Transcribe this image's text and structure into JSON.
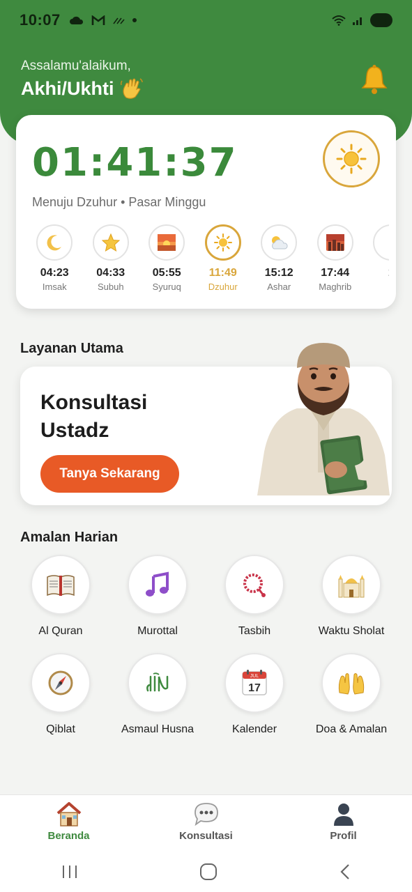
{
  "status_bar": {
    "time": "10:07",
    "battery": "73"
  },
  "header": {
    "greeting": "Assalamu'alaikum,",
    "username": "Akhi/Ukhti"
  },
  "prayer_card": {
    "countdown": "01:41:37",
    "subtitle": "Menuju Dzuhur • Pasar Minggu",
    "prayers": [
      {
        "time": "04:23",
        "name": "Imsak",
        "icon": "crescent-moon-icon",
        "active": false
      },
      {
        "time": "04:33",
        "name": "Subuh",
        "icon": "star-icon",
        "active": false
      },
      {
        "time": "05:55",
        "name": "Syuruq",
        "icon": "sunrise-icon",
        "active": false
      },
      {
        "time": "11:49",
        "name": "Dzuhur",
        "icon": "sun-icon",
        "active": true
      },
      {
        "time": "15:12",
        "name": "Ashar",
        "icon": "sun-cloud-icon",
        "active": false
      },
      {
        "time": "17:44",
        "name": "Maghrib",
        "icon": "sunset-icon",
        "active": false
      },
      {
        "time": "1",
        "name": "",
        "icon": "partial-icon",
        "active": false
      }
    ]
  },
  "layanan": {
    "title": "Layanan Utama",
    "card_title": "Konsultasi Ustadz",
    "button": "Tanya Sekarang"
  },
  "amalan": {
    "title": "Amalan Harian",
    "items": [
      {
        "label": "Al Quran",
        "icon": "quran-book-icon"
      },
      {
        "label": "Murottal",
        "icon": "music-note-icon"
      },
      {
        "label": "Tasbih",
        "icon": "prayer-beads-icon"
      },
      {
        "label": "Waktu Sholat",
        "icon": "mosque-icon"
      },
      {
        "label": "Qiblat",
        "icon": "compass-icon"
      },
      {
        "label": "Asmaul Husna",
        "icon": "allah-calligraphy-icon"
      },
      {
        "label": "Kalender",
        "icon": "calendar-icon"
      },
      {
        "label": "Doa & Amalan",
        "icon": "praying-hands-icon"
      }
    ]
  },
  "calendar_icon_text": {
    "month": "JUL",
    "day": "17"
  },
  "bottom_nav": {
    "items": [
      {
        "label": "Beranda",
        "icon": "home-icon",
        "active": true
      },
      {
        "label": "Konsultasi",
        "icon": "chat-bubble-icon",
        "active": false
      },
      {
        "label": "Profil",
        "icon": "profile-icon",
        "active": false
      }
    ]
  },
  "colors": {
    "primary_green": "#3f8a3f",
    "accent_gold": "#d9a63b",
    "button_orange": "#e85a26"
  }
}
